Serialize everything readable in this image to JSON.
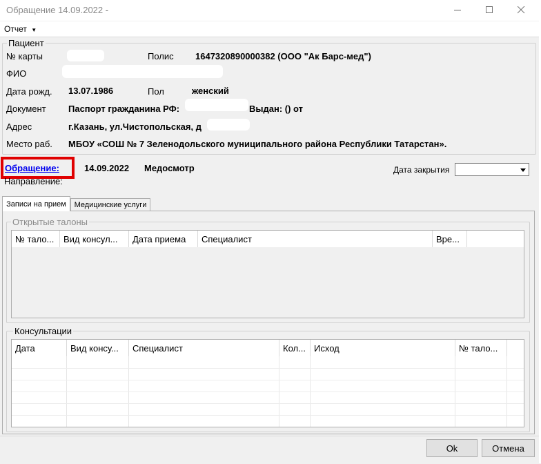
{
  "window": {
    "title": "Обращение 14.09.2022 -"
  },
  "menu": {
    "report_label": "Отчет"
  },
  "patient": {
    "group_title": "Пациент",
    "card_label": "№ карты",
    "policy_label": "Полис",
    "policy_value": "1647320890000382 (ООО \"Ак Барс-мед\")",
    "fio_label": "ФИО",
    "birth_label": "Дата рожд.",
    "birth_value": "13.07.1986",
    "sex_label": "Пол",
    "sex_value": "женский",
    "document_label": "Документ",
    "document_value": "Паспорт гражданина РФ:",
    "issued_value": "Выдан: () от",
    "address_label": "Адрес",
    "address_value": "г.Казань, ул.Чистопольская, д",
    "work_label": "Место раб.",
    "work_value": "МБОУ «СОШ № 7 Зеленодольского муниципального района Республики Татарстан»."
  },
  "appeal": {
    "link_label": "Обращение:",
    "date": "14.09.2022",
    "type": "Медосмотр",
    "direction_label": "Направление:",
    "close_date_label": "Дата закрытия",
    "close_date_value": ""
  },
  "tabs": [
    {
      "label": "Записи на прием"
    },
    {
      "label": "Медицинские услуги"
    }
  ],
  "open_tickets": {
    "title": "Открытые талоны",
    "columns": [
      "№ тало...",
      "Вид консул...",
      "Дата приема",
      "Специалист",
      "Вре..."
    ]
  },
  "consultations": {
    "title": "Консультации",
    "columns": [
      "Дата",
      "Вид консу...",
      "Специалист",
      "Кол...",
      "Исход",
      "№ тало..."
    ]
  },
  "buttons": {
    "ok": "Ok",
    "cancel": "Отмена"
  },
  "icons": {
    "minimize": "minimize-icon",
    "maximize": "maximize-icon",
    "close": "close-icon",
    "dropdown": "dropdown-arrow-icon"
  }
}
